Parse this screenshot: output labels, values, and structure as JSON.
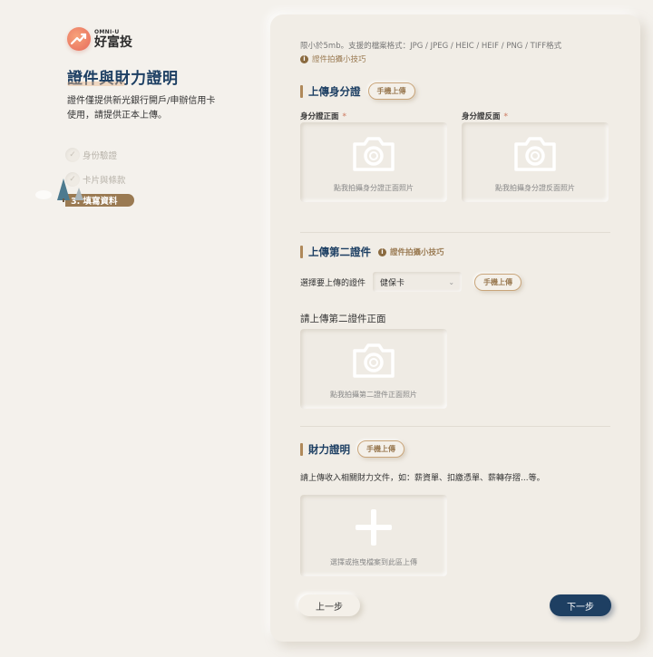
{
  "brand": {
    "sub": "OMNI-U",
    "name": "好富投"
  },
  "sidebar": {
    "title": "證件與財力證明",
    "description": "證件僅提供新光銀行開戶/申辦信用卡使用，請提供正本上傳。",
    "steps": [
      {
        "label": "身份驗證",
        "done": true
      },
      {
        "label": "卡片與條款",
        "done": true
      },
      {
        "label": "3. 填寫資料",
        "active": true
      }
    ]
  },
  "panel": {
    "format_hint": "限小於5mb。支援的檔案格式：JPG / JPEG / HEIC / HEIF / PNG / TIFF格式",
    "tip_link": "證件拍攝小技巧",
    "id_section": {
      "title": "上傳身分證",
      "mobile_button": "手機上傳",
      "front_label": "身分證正面",
      "back_label": "身分證反面",
      "required_mark": "*",
      "front_caption": "點我拍攝身分證正面照片",
      "back_caption": "點我拍攝身分證反面照片"
    },
    "second_id_section": {
      "title": "上傳第二證件",
      "tip_link": "證件拍攝小技巧",
      "select_label": "選擇要上傳的證件",
      "select_value": "健保卡",
      "mobile_button": "手機上傳",
      "subheading": "請上傳第二證件正面",
      "front_caption": "點我拍攝第二證件正面照片"
    },
    "finance_section": {
      "title": "財力證明",
      "mobile_button": "手機上傳",
      "description": "請上傳收入相關財力文件，如：薪資單、扣繳憑單、薪轉存摺...等。",
      "upload_caption": "選擇或拖曳檔案到此區上傳"
    },
    "buttons": {
      "prev": "上一步",
      "next": "下一步"
    }
  }
}
